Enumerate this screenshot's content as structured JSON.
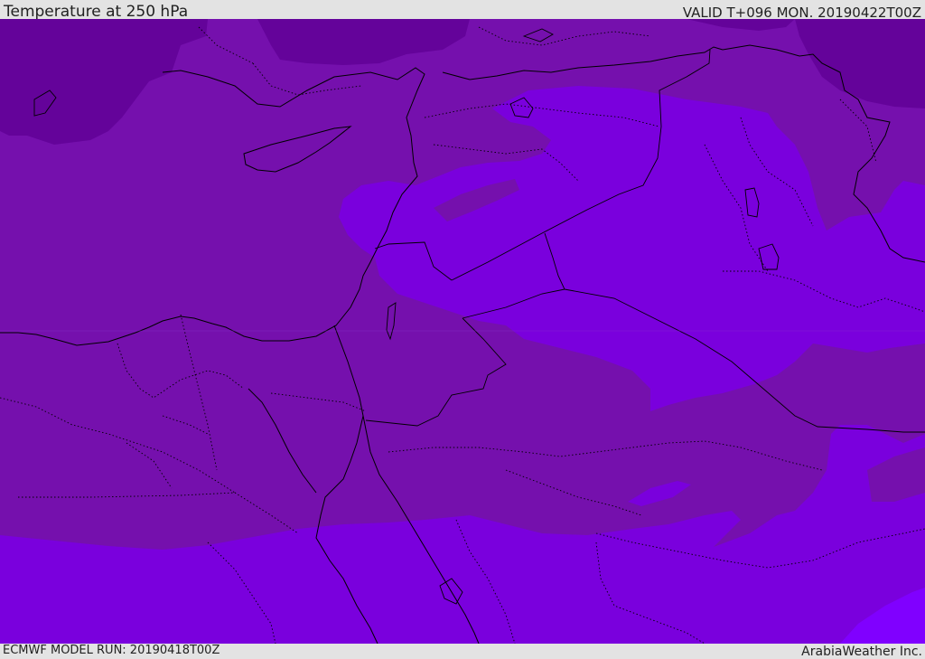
{
  "header": {
    "title": "Temperature at 250 hPa",
    "valid_time": "VALID T+096 MON. 20190422T00Z"
  },
  "footer": {
    "model_run": "ECMWF MODEL RUN: 20190418T00Z",
    "credit": "ArabiaWeather Inc."
  },
  "colors": {
    "dark_purple": "#64039a",
    "mid_purple": "#7510ad",
    "violet": "#7a00dd",
    "bright_violet": "#8000ff",
    "border": "#000000",
    "background": "#e3e3e3"
  }
}
